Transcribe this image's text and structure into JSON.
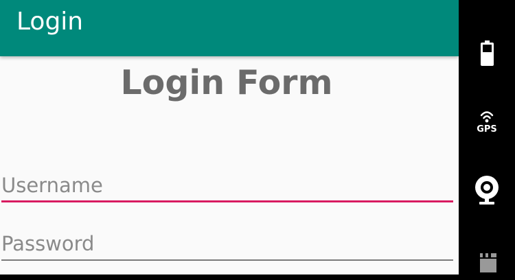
{
  "app_bar": {
    "title": "Login",
    "color": "#00897b"
  },
  "form": {
    "title": "Login Form",
    "username": {
      "placeholder": "Username",
      "value": "",
      "focused": true,
      "accent_color": "#d81b60"
    },
    "password": {
      "placeholder": "Password",
      "value": ""
    }
  },
  "emulator_controls": {
    "buttons": [
      {
        "icon": "battery-icon"
      },
      {
        "icon": "gps-icon",
        "label": "GPS"
      },
      {
        "icon": "camera-icon"
      },
      {
        "icon": "video-icon"
      }
    ]
  }
}
